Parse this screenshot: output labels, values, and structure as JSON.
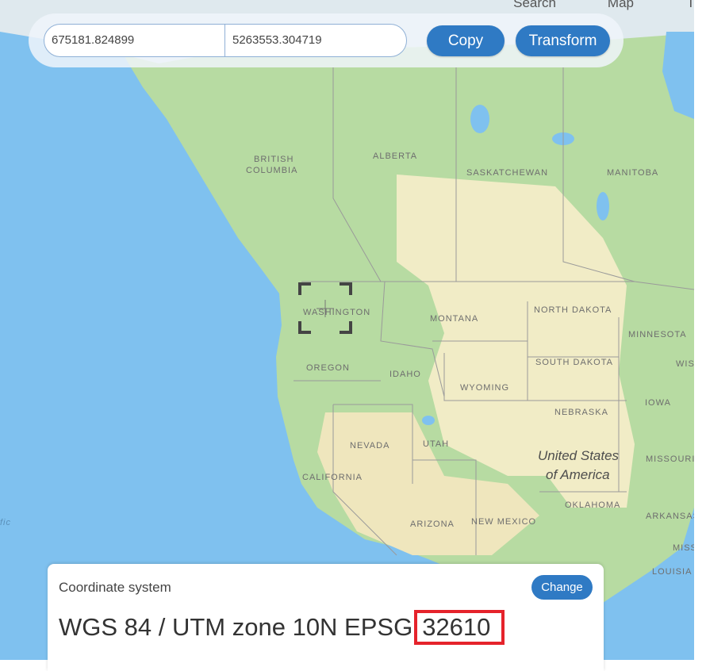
{
  "nav": {
    "items": [
      "Search",
      "Map",
      "Tr"
    ]
  },
  "inputs": {
    "x_value": "675181.824899",
    "y_value": "5263553.304719"
  },
  "buttons": {
    "copy": "Copy",
    "transform": "Transform",
    "change": "Change"
  },
  "map": {
    "labels": {
      "british_columbia_1": "BRITISH",
      "british_columbia_2": "COLUMBIA",
      "alberta": "ALBERTA",
      "saskatchewan": "SASKATCHEWAN",
      "manitoba": "MANITOBA",
      "washington": "WASHINGTON",
      "montana": "MONTANA",
      "north_dakota": "NORTH DAKOTA",
      "minnesota": "MINNESOTA",
      "wis": "WIS",
      "south_dakota": "SOUTH DAKOTA",
      "oregon": "OREGON",
      "idaho": "IDAHO",
      "wyoming": "WYOMING",
      "iowa": "IOWA",
      "nebraska": "NEBRASKA",
      "nevada": "NEVADA",
      "utah": "UTAH",
      "usa_1": "United States",
      "usa_2": "of America",
      "missouri": "MISSOURI",
      "california": "CALIFORNIA",
      "oklahoma": "OKLAHOMA",
      "arizona": "ARIZONA",
      "new_mexico": "NEW MEXICO",
      "arkansas": "ARKANSAS",
      "miss": "MISS",
      "louisiana": "LOUISIA",
      "pacific": "fic"
    },
    "colors": {
      "ocean": "#7fc1ef",
      "land": "#b7dba2",
      "dry": "#f1ecc6"
    }
  },
  "panel": {
    "label": "Coordinate system",
    "crs_name": "WGS 84 / UTM zone 10N EPSG",
    "crs_code": "32610"
  },
  "colors": {
    "accent": "#2f7ac4",
    "highlight": "#e5232b"
  }
}
